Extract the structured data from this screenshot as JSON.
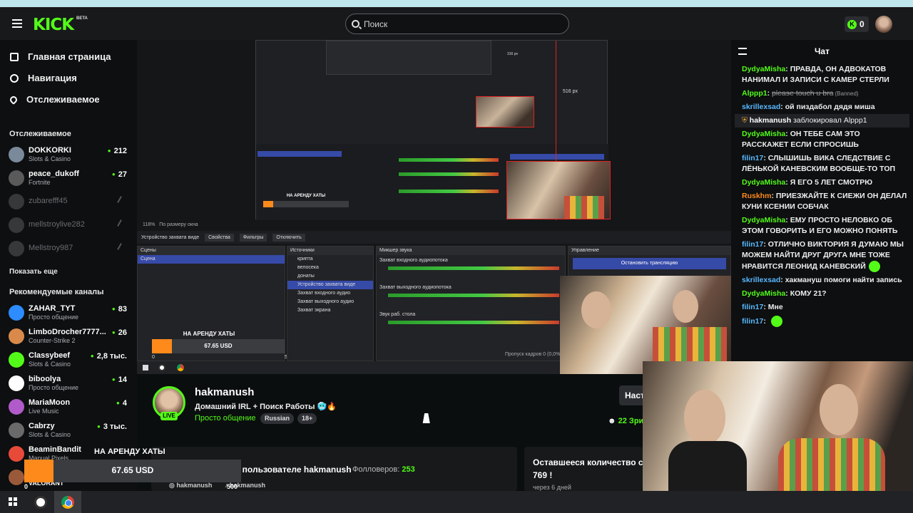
{
  "header": {
    "logo": "KICK",
    "logo_badge": "BETA",
    "search_placeholder": "Поиск",
    "kicks_count": "0"
  },
  "sidebar": {
    "nav": [
      {
        "label": "Главная страница",
        "icon": "home-icon"
      },
      {
        "label": "Навигация",
        "icon": "compass-icon"
      },
      {
        "label": "Отслеживаемое",
        "icon": "heart-icon"
      }
    ],
    "following_title": "Отслеживаемое",
    "following": [
      {
        "name": "DOKKORKI",
        "category": "Slots & Casino",
        "viewers": "212",
        "live": true
      },
      {
        "name": "peace_dukoff",
        "category": "Fortnite",
        "viewers": "27",
        "live": true
      },
      {
        "name": "zubarefff45",
        "live": false
      },
      {
        "name": "mellstroylive282",
        "live": false
      },
      {
        "name": "Mellstroy987",
        "live": false
      }
    ],
    "show_more": "Показать еще",
    "recommended_title": "Рекомендуемые каналы",
    "recommended": [
      {
        "name": "ZAHAR_TYT",
        "category": "Просто общение",
        "viewers": "83",
        "color": "#2d8cff"
      },
      {
        "name": "LimboDrocher7777...",
        "category": "Counter-Strike 2",
        "viewers": "26",
        "color": "#d98a4a"
      },
      {
        "name": "Classybeef",
        "category": "Slots & Casino",
        "viewers": "2,8 тыс.",
        "color": "#53fc18"
      },
      {
        "name": "biboolya",
        "category": "Просто общение",
        "viewers": "14",
        "color": "#ffffff"
      },
      {
        "name": "MariaMoon",
        "category": "Live Music",
        "viewers": "4",
        "color": "#b15ac9"
      },
      {
        "name": "Cabrzy",
        "category": "Slots & Casino",
        "viewers": "3 тыс.",
        "color": "#6a6a6a"
      },
      {
        "name": "BeaminBandit",
        "category": "Manual Pixels",
        "viewers": "",
        "color": "#e84a3a"
      },
      {
        "name": "",
        "category": "VALORANT",
        "viewers": "",
        "color": "#9a5a3a"
      }
    ]
  },
  "obs": {
    "scene_panel": "Сцены",
    "scene_item": "Сцена",
    "sources_panel": "Источники",
    "sources": [
      "крипта",
      "велосека",
      "донаты",
      "Устройство захвата виде",
      "Захват входного аудио",
      "Захват выходного аудио",
      "Захват экрана"
    ],
    "mixer_panel": "Микшер звука",
    "mixer_tracks": [
      "Захват входного аудиопотока",
      "Захват выходного аудиопотока",
      "Звук раб. стола"
    ],
    "controls_panel": "Управление",
    "stop_stream": "Остановить трансляцию",
    "toolbar_device": "Устройство захвата виде",
    "toolbar_props": "Свойства",
    "toolbar_filters": "Фильтры",
    "toolbar_off": "Отключить",
    "zoom_label": "118%",
    "fit_label": "По размеру окна",
    "frames_dropped": "Пропуск кадров 0 (0,0%)",
    "overlay_rent_title": "НА АРЕНДУ ХАТЫ",
    "overlay_rent_amount": "67.65 USD",
    "overlay_rent_max": "500",
    "overlay_rent_min": "0",
    "measure_label": "516 px",
    "measure_label_small": "316 px"
  },
  "stream": {
    "streamer": "hakmanush",
    "title": "Домашний IRL + Поиск Работы",
    "category": "Просто общение",
    "tags": [
      "Russian",
      "18+"
    ],
    "live_label": "LIVE",
    "viewers": "22 Зри",
    "settings_label": "Наст",
    "about_title": "О пользователе hakmanush",
    "followers_label": "Фолловеров:",
    "followers_count": "253",
    "social_1": "hakmanush",
    "social_2": "hakmanush",
    "remaining_title": "Оставшееся количество с",
    "remaining_value": "769 !",
    "remaining_sub": "через 6 дней"
  },
  "rent_overlay": {
    "title": "НА АРЕНДУ ХАТЫ",
    "amount": "67.65 USD",
    "min": "0",
    "max": "500",
    "progress_fraction": 0.135
  },
  "chat": {
    "title": "Чат",
    "messages": [
      {
        "user": "DydyaMisha",
        "color": "#53fc18",
        "text": "ПРАВДА, ОН АДВОКАТОВ НАНИМАЛ И ЗАПИСИ С КАМЕР СТЕРЛИ"
      },
      {
        "user": "Alppp1",
        "color": "#53fc18",
        "text": "please touch u bra",
        "banned": "(Banned)"
      },
      {
        "user": "skrillexsad",
        "color": "#5ab8ff",
        "text": "ой пиздабол дядя миша"
      },
      {
        "user": "hakmanush",
        "color": "#ffffff",
        "text": "заблокировал Alppp1",
        "system": true
      },
      {
        "user": "DydyaMisha",
        "color": "#53fc18",
        "text": "ОН ТЕБЕ САМ ЭТО РАССКАЖЕТ ЕСЛИ СПРОСИШЬ"
      },
      {
        "user": "filin17",
        "color": "#5ab8ff",
        "text": "СЛЫШИШЬ ВИКА СЛЕДСТВИЕ С ЛЁНЬКОЙ КАНЕВСКИМ ВООБЩЕ-ТО ТОП"
      },
      {
        "user": "DydyaMisha",
        "color": "#53fc18",
        "text": "Я ЕГО 5 ЛЕТ СМОТРЮ"
      },
      {
        "user": "Ruskhm",
        "color": "#ff8a1c",
        "text": "ПРИЕЗЖАЙТЕ К СИЕЖИ ОН ДЕЛАЛ КУНИ КСЕНИИ СОБЧАК"
      },
      {
        "user": "DydyaMisha",
        "color": "#53fc18",
        "text": "ЕМУ ПРОСТО НЕЛОВКО ОБ ЭТОМ ГОВОРИТЬ И ЕГО МОЖНО ПОНЯТЬ"
      },
      {
        "user": "filin17",
        "color": "#5ab8ff",
        "text": "ОТЛИЧНО ВИКТОРИЯ Я ДУМАЮ МЫ МОЖЕМ НАЙТИ ДРУГ ДРУГА МНЕ ТОЖЕ НРАВИТСЯ ЛЕОНИД КАНЕВСКИЙ",
        "emote": true
      },
      {
        "user": "skrillexsad",
        "color": "#5ab8ff",
        "text": "хакмануш помоги найти запись"
      },
      {
        "user": "DydyaMisha",
        "color": "#53fc18",
        "text": "КОМУ 21?"
      },
      {
        "user": "filin17",
        "color": "#5ab8ff",
        "text": "Мне"
      },
      {
        "user": "filin17",
        "color": "#5ab8ff",
        "text": "",
        "emote": true
      }
    ]
  },
  "taskbar": {
    "apps": [
      "windows-start-icon",
      "obs-icon",
      "chrome-icon"
    ]
  }
}
